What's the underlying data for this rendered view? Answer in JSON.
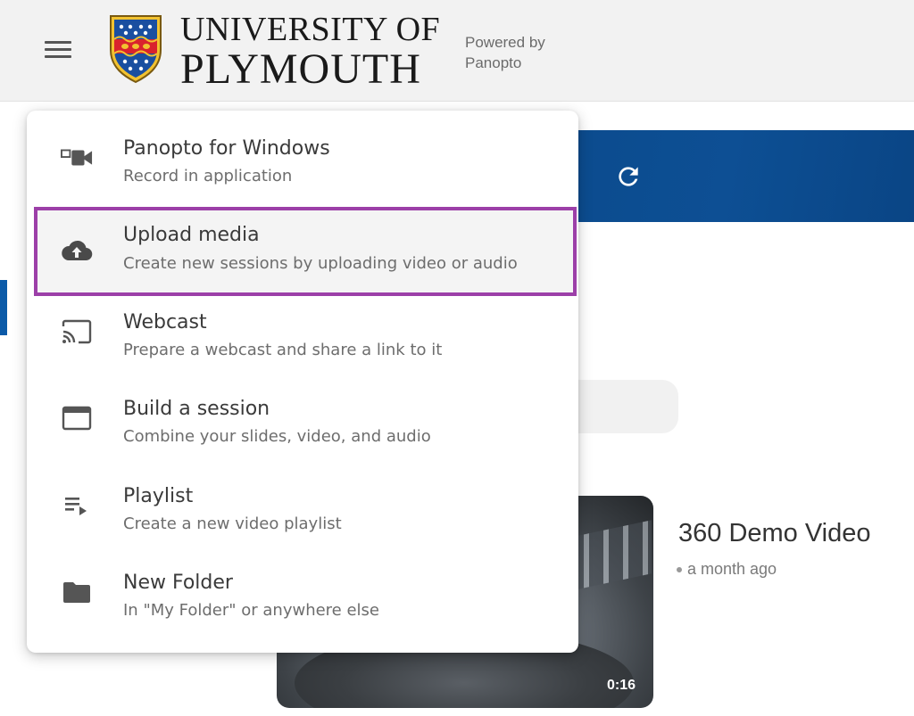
{
  "header": {
    "brand_line1": "UNIVERSITY OF",
    "brand_line2": "PLYMOUTH",
    "powered_line1": "Powered by",
    "powered_line2": "Panopto",
    "menu_icon": "hamburger-menu-icon",
    "crest_colors": {
      "shield": "#1a4fa0",
      "band": "#d9232d",
      "gold": "#f2c230"
    }
  },
  "background": {
    "banner_text": "r",
    "video": {
      "title": "360 Demo Video",
      "meta": "a month ago",
      "duration": "0:16"
    },
    "accent_color": "#0b4a8c"
  },
  "create_menu": {
    "highlight_color": "#9c3fa8",
    "items": [
      {
        "title": "Panopto for Windows",
        "description": "Record in application",
        "icon": "video-camera-icon"
      },
      {
        "title": "Upload media",
        "description": "Create new sessions by uploading video or audio",
        "icon": "cloud-upload-icon"
      },
      {
        "title": "Webcast",
        "description": "Prepare a webcast and share a link to it",
        "icon": "cast-icon"
      },
      {
        "title": "Build a session",
        "description": "Combine your slides, video, and audio",
        "icon": "window-icon"
      },
      {
        "title": "Playlist",
        "description": "Create a new video playlist",
        "icon": "playlist-icon"
      },
      {
        "title": "New Folder",
        "description": "In \"My Folder\" or anywhere else",
        "icon": "folder-icon"
      }
    ]
  }
}
